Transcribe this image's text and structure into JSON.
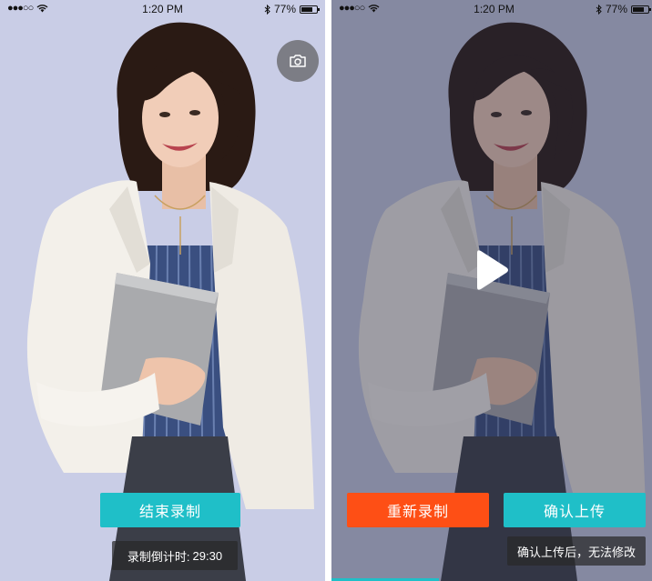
{
  "left_screen": {
    "status": {
      "signal": "●●●○○",
      "time": "1:20 PM",
      "battery": "77%",
      "battery_level": 0.77
    },
    "camera_icon": "camera-switch-icon",
    "end_recording_label": "结束录制",
    "countdown_label": "录制倒计时:",
    "countdown_value": "29:30"
  },
  "right_screen": {
    "status": {
      "signal": "●●●○○",
      "time": "1:20 PM",
      "battery": "77%",
      "battery_level": 0.77
    },
    "play_icon": "play-icon",
    "rerecord_label": "重新录制",
    "confirm_upload_label": "确认上传",
    "notice_text": "确认上传后，无法修改"
  },
  "colors": {
    "background": "#c9cde6",
    "teal": "#1fbfc8",
    "red": "#fe4f15"
  }
}
